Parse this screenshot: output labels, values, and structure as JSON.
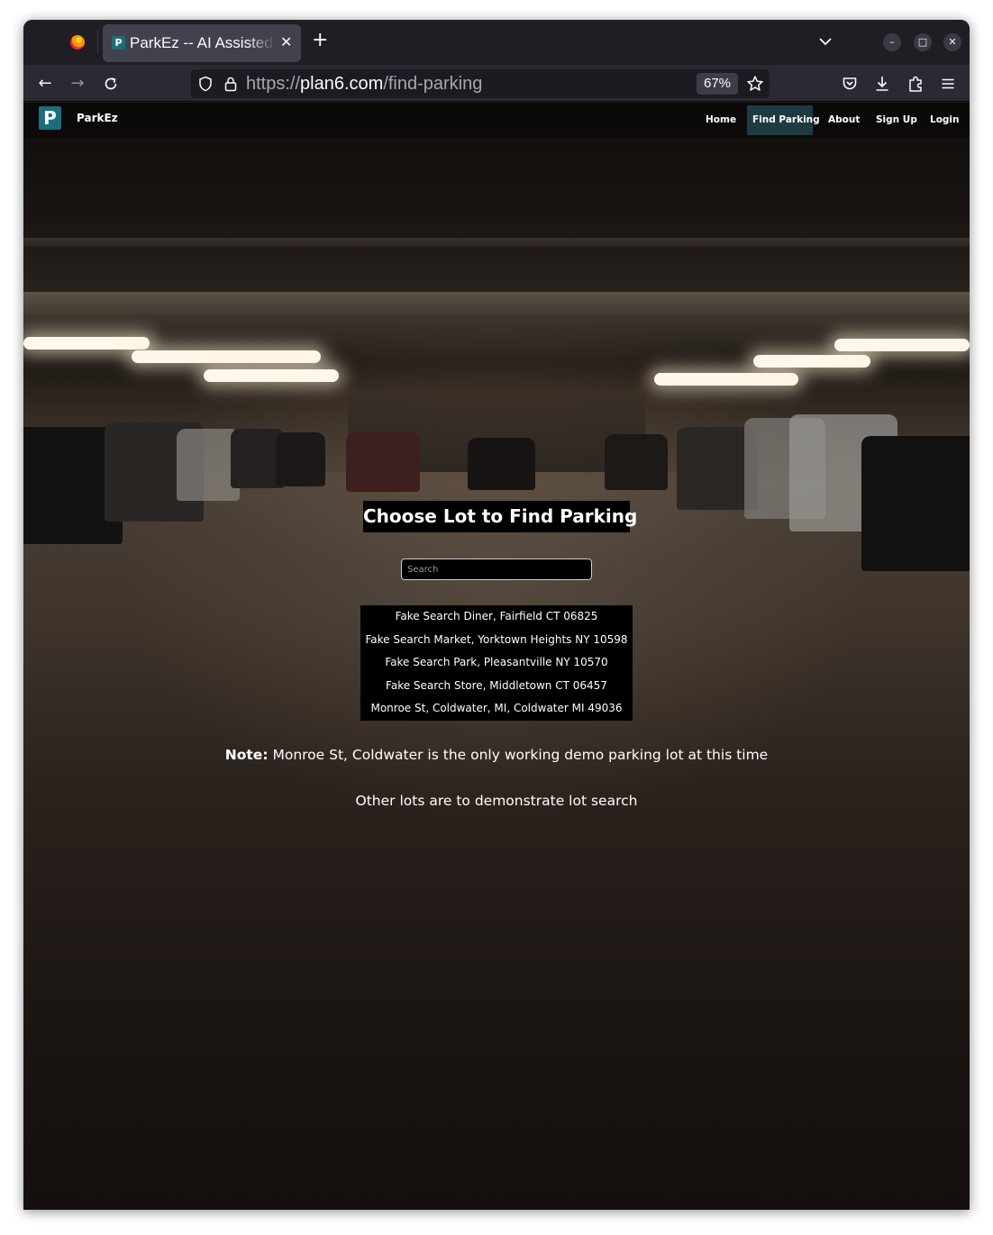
{
  "browser": {
    "tab_title": "ParkEz -- AI Assisted Parking",
    "tab_favicon": "P",
    "url_scheme": "https://",
    "url_host": "plan6.com",
    "url_path": "/find-parking",
    "zoom": "67%"
  },
  "site": {
    "brand": "ParkEz",
    "logo_letter": "P",
    "nav": [
      {
        "label": "Home",
        "active": false
      },
      {
        "label": "Find Parking",
        "active": true
      },
      {
        "label": "About",
        "active": false
      },
      {
        "label": "Sign Up",
        "active": false
      },
      {
        "label": "Login",
        "active": false
      }
    ]
  },
  "main": {
    "heading": "Choose Lot to Find Parking",
    "search_placeholder": "Search",
    "lots": [
      "Fake Search Diner, Fairfield CT 06825",
      "Fake Search Market, Yorktown Heights NY 10598",
      "Fake Search Park, Pleasantville NY 10570",
      "Fake Search Store, Middletown CT 06457",
      "Monroe St, Coldwater, MI, Coldwater MI 49036"
    ],
    "note_label": "Note:",
    "note_text": " Monroe St, Coldwater is the only working demo parking lot at this time",
    "other_text": "Other lots are to demonstrate lot search"
  },
  "colors": {
    "brand_teal": "#1b6f7d",
    "active_nav_bg": "#1e3b42",
    "browser_chrome": "#2b2a33"
  },
  "icons": {
    "firefox": "firefox-logo-icon",
    "back": "back-arrow-icon",
    "forward": "forward-arrow-icon",
    "reload": "reload-icon",
    "shield": "shield-icon",
    "lock": "lock-icon",
    "bookmark": "star-icon",
    "pocket": "pocket-icon",
    "downloads": "download-icon",
    "extensions": "puzzle-icon",
    "menu": "hamburger-menu-icon"
  }
}
